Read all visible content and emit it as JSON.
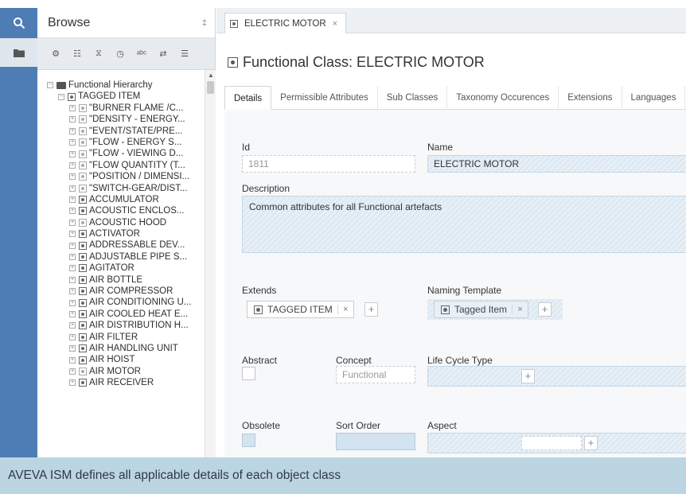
{
  "rail": {
    "search_icon": "search-icon",
    "folder_icon": "folder-icon",
    "accent": "#4d7db4"
  },
  "browse": {
    "title": "Browse",
    "pin_glyph": "‡",
    "toolbar_glyphs": [
      "⚙",
      "☷",
      "⧖",
      "◷",
      "ᵃᵇᶜ",
      "⇄",
      "☰"
    ],
    "tree": {
      "root": "Functional Hierarchy",
      "tagged": "TAGGED ITEM",
      "items": [
        "\"BURNER FLAME /C...",
        "\"DENSITY - ENERGY...",
        "\"EVENT/STATE/PRE...",
        "\"FLOW - ENERGY S...",
        "\"FLOW - VIEWING D...",
        "\"FLOW QUANTITY (T...",
        "\"POSITION / DIMENSI...",
        "\"SWITCH-GEAR/DIST...",
        "ACCUMULATOR",
        "ACOUSTIC ENCLOS...",
        "ACOUSTIC HOOD",
        "ACTIVATOR",
        "ADDRESSABLE DEV...",
        "ADJUSTABLE PIPE S...",
        "AGITATOR",
        "AIR BOTTLE",
        "AIR COMPRESSOR",
        "AIR CONDITIONING U...",
        "AIR COOLED HEAT E...",
        "AIR DISTRIBUTION H...",
        "AIR FILTER",
        "AIR HANDLING UNIT",
        "AIR HOIST",
        "AIR MOTOR",
        "AIR RECEIVER"
      ]
    }
  },
  "main": {
    "doc_tab": "ELECTRIC MOTOR",
    "doc_tab_close": "×",
    "title": "Functional Class: ELECTRIC MOTOR",
    "tabs": [
      "Details",
      "Permissible Attributes",
      "Sub Classes",
      "Taxonomy Occurences",
      "Extensions",
      "Languages"
    ],
    "form": {
      "id_label": "Id",
      "id_value": "1811",
      "name_label": "Name",
      "name_value": "ELECTRIC MOTOR",
      "description_label": "Description",
      "description_value": "Common attributes for all Functional artefacts",
      "extends_label": "Extends",
      "extends_chip": "TAGGED ITEM",
      "naming_template_label": "Naming Template",
      "naming_template_chip": "Tagged Item",
      "chip_remove": "×",
      "plus": "+",
      "abstract_label": "Abstract",
      "concept_label": "Concept",
      "concept_value": "Functional",
      "life_cycle_label": "Life Cycle Type",
      "obsolete_label": "Obsolete",
      "sort_order_label": "Sort Order",
      "aspect_label": "Aspect"
    }
  },
  "caption": "AVEVA ISM defines all applicable details of each object class"
}
